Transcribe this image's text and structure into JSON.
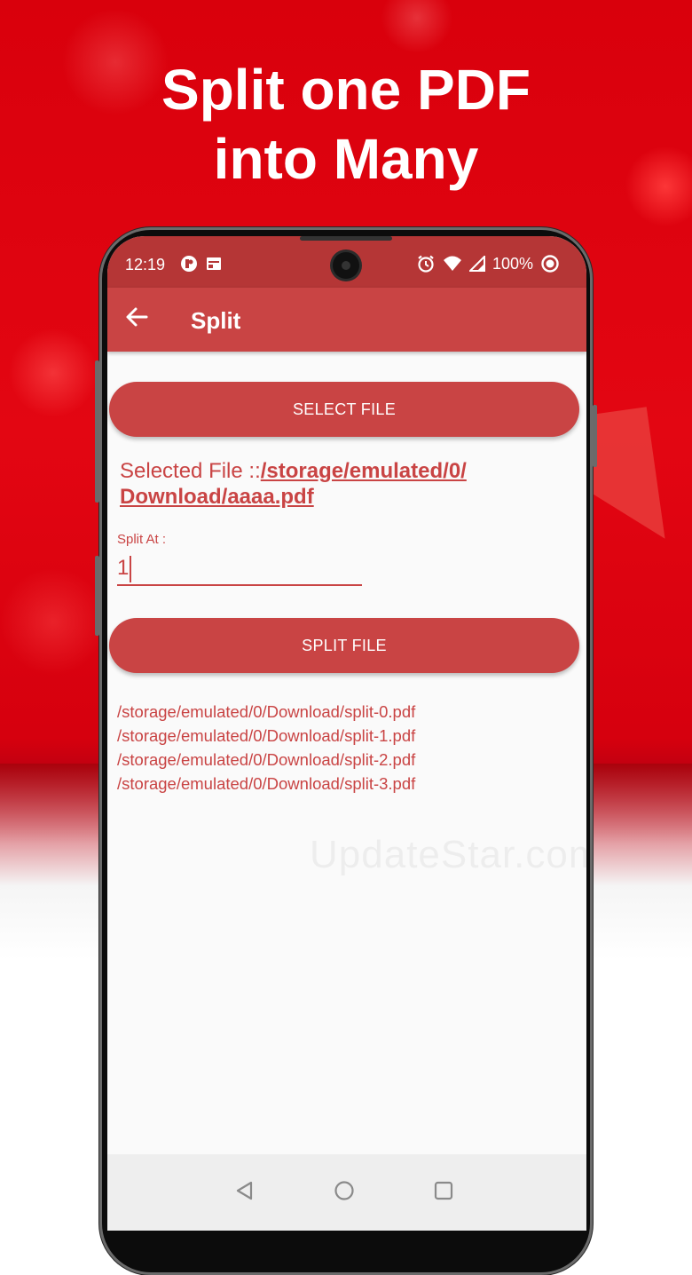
{
  "headline": {
    "line1": "Split one PDF",
    "line2": "into Many"
  },
  "status_bar": {
    "time": "12:19",
    "battery": "100%"
  },
  "app_bar": {
    "title": "Split"
  },
  "buttons": {
    "select_file": "SELECT FILE",
    "split_file": "SPLIT FILE"
  },
  "selected_file": {
    "label": "Selected File ::",
    "path_line1": "/storage/emulated/0/",
    "path_line2": "Download/aaaa.pdf"
  },
  "split_at": {
    "label": "Split At :",
    "value": "1"
  },
  "results": [
    "/storage/emulated/0/Download/split-0.pdf",
    "/storage/emulated/0/Download/split-1.pdf",
    "/storage/emulated/0/Download/split-2.pdf",
    "/storage/emulated/0/Download/split-3.pdf"
  ],
  "watermark": "UpdateStar.com",
  "colors": {
    "primary": "#c94444",
    "status_bar": "#b53636",
    "background_red": "#e30612"
  }
}
